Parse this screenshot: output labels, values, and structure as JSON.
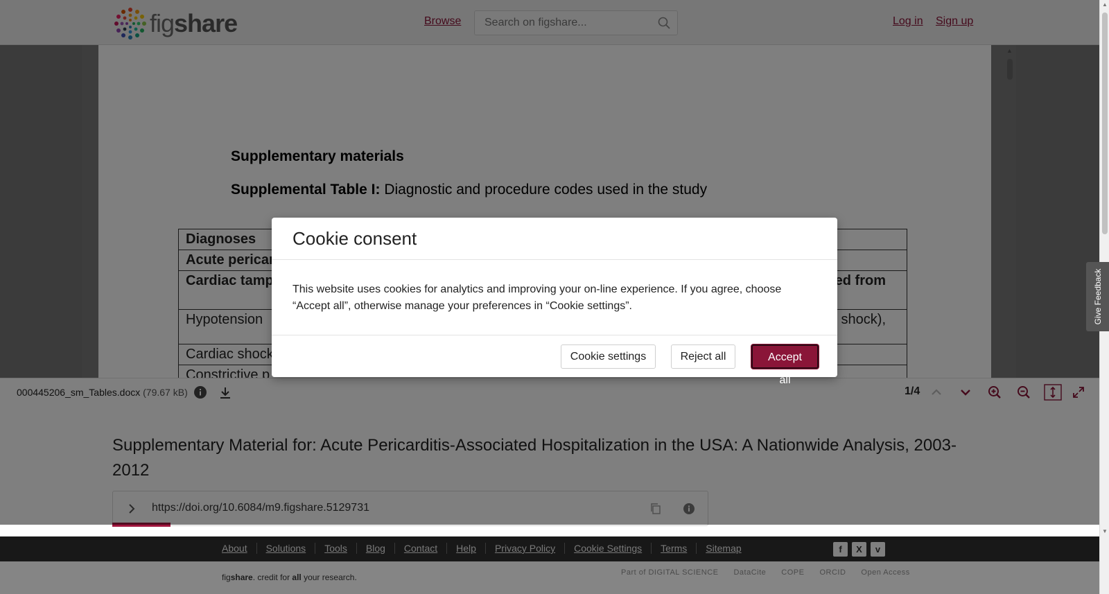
{
  "header": {
    "logo_text_a": "fig",
    "logo_text_b": "share",
    "browse": "Browse",
    "search_placeholder": "Search on figshare...",
    "login": "Log in",
    "signup": "Sign up"
  },
  "document": {
    "heading": "Supplementary materials",
    "table_title_bold": "Supplemental Table I:",
    "table_title_rest": " Diagnostic and procedure codes used in the study",
    "rows": [
      "Diagnoses",
      "Acute pericar",
      "Cardiac tamp",
      "Hypotension",
      "Cardiac shock",
      "Constrictive p"
    ],
    "row_right_2": "ated from",
    "row_right_3": "shock),"
  },
  "viewer_toolbar": {
    "filename": "000445206_sm_Tables.docx",
    "filesize": "(79.67 kB)",
    "pager": "1/4"
  },
  "item": {
    "title": "Supplementary Material for: Acute Pericarditis-Associated Hospitalization in the USA: A Nationwide Analysis, 2003-2012",
    "doi": "https://doi.org/10.6084/m9.figshare.5129731"
  },
  "footer": {
    "links": [
      "About",
      "Solutions",
      "Tools",
      "Blog",
      "Contact",
      "Help",
      "Privacy Policy",
      "Cookie Settings",
      "Terms",
      "Sitemap"
    ],
    "social": [
      "f",
      "X",
      "v"
    ],
    "tagline_a": "fig",
    "tagline_b": "share",
    "tagline_c": ". credit for ",
    "tagline_d": "all",
    "tagline_e": " your research.",
    "partners": [
      "Part of DIGITAL SCIENCE",
      "DataCite",
      "COPE",
      "ORCID",
      "Open Access"
    ]
  },
  "feedback": "Give Feedback",
  "cookie": {
    "title": "Cookie consent",
    "body": "This website uses cookies for analytics and improving your on-line experience. If you agree, choose “Accept all”, otherwise manage your preferences in “Cookie settings”.",
    "settings": "Cookie settings",
    "reject": "Reject all",
    "accept": "Accept all"
  },
  "colors": {
    "brand": "#8a1538",
    "footer_dark": "#2d2d2d"
  }
}
